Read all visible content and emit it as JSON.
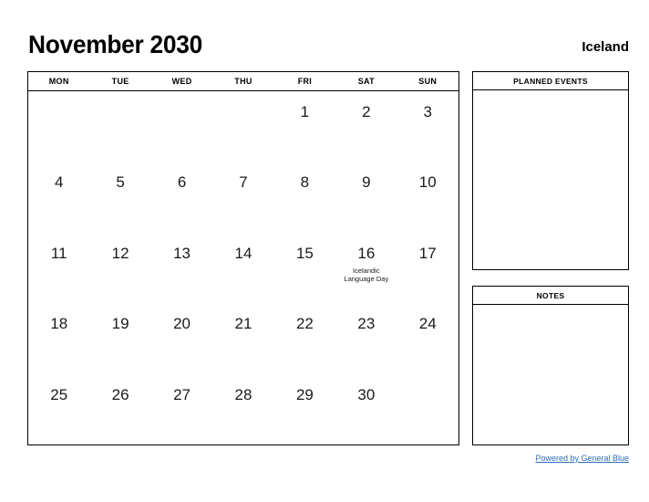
{
  "header": {
    "title": "November 2030",
    "country": "Iceland"
  },
  "calendar": {
    "weekday_headers": [
      "MON",
      "TUE",
      "WED",
      "THU",
      "FRI",
      "SAT",
      "SUN"
    ],
    "weeks": [
      [
        {
          "day": "",
          "event": ""
        },
        {
          "day": "",
          "event": ""
        },
        {
          "day": "",
          "event": ""
        },
        {
          "day": "",
          "event": ""
        },
        {
          "day": "1",
          "event": ""
        },
        {
          "day": "2",
          "event": ""
        },
        {
          "day": "3",
          "event": ""
        }
      ],
      [
        {
          "day": "4",
          "event": ""
        },
        {
          "day": "5",
          "event": ""
        },
        {
          "day": "6",
          "event": ""
        },
        {
          "day": "7",
          "event": ""
        },
        {
          "day": "8",
          "event": ""
        },
        {
          "day": "9",
          "event": ""
        },
        {
          "day": "10",
          "event": ""
        }
      ],
      [
        {
          "day": "11",
          "event": ""
        },
        {
          "day": "12",
          "event": ""
        },
        {
          "day": "13",
          "event": ""
        },
        {
          "day": "14",
          "event": ""
        },
        {
          "day": "15",
          "event": ""
        },
        {
          "day": "16",
          "event": "Icelandic Language Day"
        },
        {
          "day": "17",
          "event": ""
        }
      ],
      [
        {
          "day": "18",
          "event": ""
        },
        {
          "day": "19",
          "event": ""
        },
        {
          "day": "20",
          "event": ""
        },
        {
          "day": "21",
          "event": ""
        },
        {
          "day": "22",
          "event": ""
        },
        {
          "day": "23",
          "event": ""
        },
        {
          "day": "24",
          "event": ""
        }
      ],
      [
        {
          "day": "25",
          "event": ""
        },
        {
          "day": "26",
          "event": ""
        },
        {
          "day": "27",
          "event": ""
        },
        {
          "day": "28",
          "event": ""
        },
        {
          "day": "29",
          "event": ""
        },
        {
          "day": "30",
          "event": ""
        },
        {
          "day": "",
          "event": ""
        }
      ]
    ]
  },
  "planned_events": {
    "title": "PLANNED EVENTS",
    "content": ""
  },
  "notes": {
    "title": "NOTES",
    "content": ""
  },
  "footer": {
    "link_label": "Powered by General Blue",
    "link_color": "#2a6ebb"
  }
}
